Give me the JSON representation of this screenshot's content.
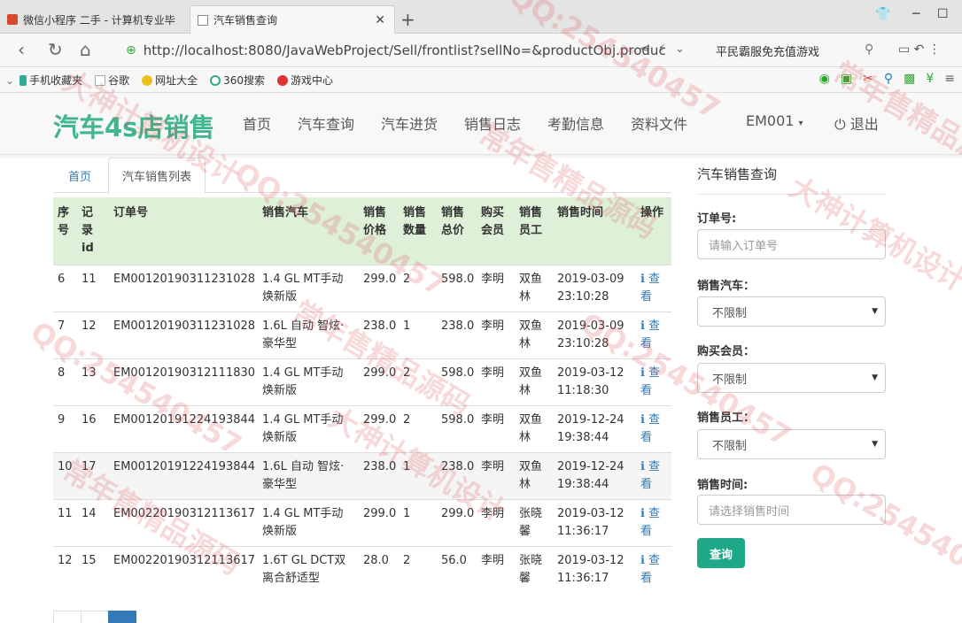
{
  "browser": {
    "tabs": [
      {
        "label": "微信小程序 二手 - 计算机专业毕"
      },
      {
        "label": "汽车销售查询"
      }
    ],
    "url": "http://localhost:8080/JavaWebProject/Sell/frontlist?sellNo=&productObj.produc",
    "search_hint": "平民霸服免充值游戏",
    "bookmarks": [
      "手机收藏夹",
      "谷歌",
      "网址大全",
      "360搜索",
      "游戏中心"
    ]
  },
  "site": {
    "brand": "汽车4s店销售",
    "nav": [
      "首页",
      "汽车查询",
      "汽车进货",
      "销售日志",
      "考勤信息",
      "资料文件"
    ],
    "user": "EM001",
    "logout": "退出"
  },
  "main": {
    "tabs": [
      "首页",
      "汽车销售列表"
    ],
    "columns": [
      {
        "label": "序号",
        "lines": [
          "序",
          "号"
        ]
      },
      {
        "label": "记录id",
        "lines": [
          "记",
          "录",
          "id"
        ]
      },
      {
        "label": "订单号",
        "lines": [
          "订单号"
        ]
      },
      {
        "label": "销售汽车",
        "lines": [
          "销售汽车"
        ]
      },
      {
        "label": "销售价格",
        "lines": [
          "销售",
          "价格"
        ]
      },
      {
        "label": "销售数量",
        "lines": [
          "销售",
          "数量"
        ]
      },
      {
        "label": "销售总价",
        "lines": [
          "销售",
          "总价"
        ]
      },
      {
        "label": "购买会员",
        "lines": [
          "购买",
          "会员"
        ]
      },
      {
        "label": "销售员工",
        "lines": [
          "销售",
          "员工"
        ]
      },
      {
        "label": "销售时间",
        "lines": [
          "销售时间"
        ]
      },
      {
        "label": "操作",
        "lines": [
          "操作"
        ]
      }
    ],
    "rows": [
      {
        "no": "6",
        "id": "11",
        "order": "EM00120190311231028",
        "car": "1.4 GL MT手动焕新版",
        "price": "299.0",
        "qty": "2",
        "total": "598.0",
        "member": "李明",
        "staff": "双鱼林",
        "time": "2019-03-09 23:10:28",
        "action": "查看"
      },
      {
        "no": "7",
        "id": "12",
        "order": "EM00120190311231028",
        "car": "1.6L 自动 智炫·豪华型",
        "price": "238.0",
        "qty": "1",
        "total": "238.0",
        "member": "李明",
        "staff": "双鱼林",
        "time": "2019-03-09 23:10:28",
        "action": "查看"
      },
      {
        "no": "8",
        "id": "13",
        "order": "EM00120190312111830",
        "car": "1.4 GL MT手动焕新版",
        "price": "299.0",
        "qty": "2",
        "total": "598.0",
        "member": "李明",
        "staff": "双鱼林",
        "time": "2019-03-12 11:18:30",
        "action": "查看"
      },
      {
        "no": "9",
        "id": "16",
        "order": "EM00120191224193844",
        "car": "1.4 GL MT手动焕新版",
        "price": "299.0",
        "qty": "2",
        "total": "598.0",
        "member": "李明",
        "staff": "双鱼林",
        "time": "2019-12-24 19:38:44",
        "action": "查看"
      },
      {
        "no": "10",
        "id": "17",
        "order": "EM00120191224193844",
        "car": "1.6L 自动 智炫·豪华型",
        "price": "238.0",
        "qty": "1",
        "total": "238.0",
        "member": "李明",
        "staff": "双鱼林",
        "time": "2019-12-24 19:38:44",
        "action": "查看"
      },
      {
        "no": "11",
        "id": "14",
        "order": "EM00220190312113617",
        "car": "1.4 GL MT手动焕新版",
        "price": "299.0",
        "qty": "1",
        "total": "299.0",
        "member": "李明",
        "staff": "张晓馨",
        "time": "2019-03-12 11:36:17",
        "action": "查看"
      },
      {
        "no": "12",
        "id": "15",
        "order": "EM00220190312113617",
        "car": "1.6T GL DCT双离合舒适型",
        "price": "28.0",
        "qty": "2",
        "total": "56.0",
        "member": "李明",
        "staff": "张晓馨",
        "time": "2019-03-12 11:36:17",
        "action": "查看"
      }
    ]
  },
  "query": {
    "title": "汽车销售查询",
    "order_label": "订单号:",
    "order_placeholder": "请输入订单号",
    "car_label": "销售汽车：",
    "car_value": "不限制",
    "member_label": "购买会员：",
    "member_value": "不限制",
    "staff_label": "销售员工：",
    "staff_value": "不限制",
    "time_label": "销售时间:",
    "time_placeholder": "请选择销售时间",
    "submit": "查询"
  },
  "watermarks": [
    "QQ:254540457",
    "常年售精品源码",
    "大神计算机设计",
    "QQ:254540457",
    "常年售精品源码",
    "大神计算机设计",
    "QQ:254540457",
    "常年售精品源码",
    "QQ:254540457",
    "大神计算机设计",
    "常年售精品源码",
    "QQ:254540457"
  ],
  "colors": {
    "brand": "#3fb68c",
    "header_row": "#dff0d8",
    "link": "#337ab7",
    "button": "#1fa887"
  }
}
